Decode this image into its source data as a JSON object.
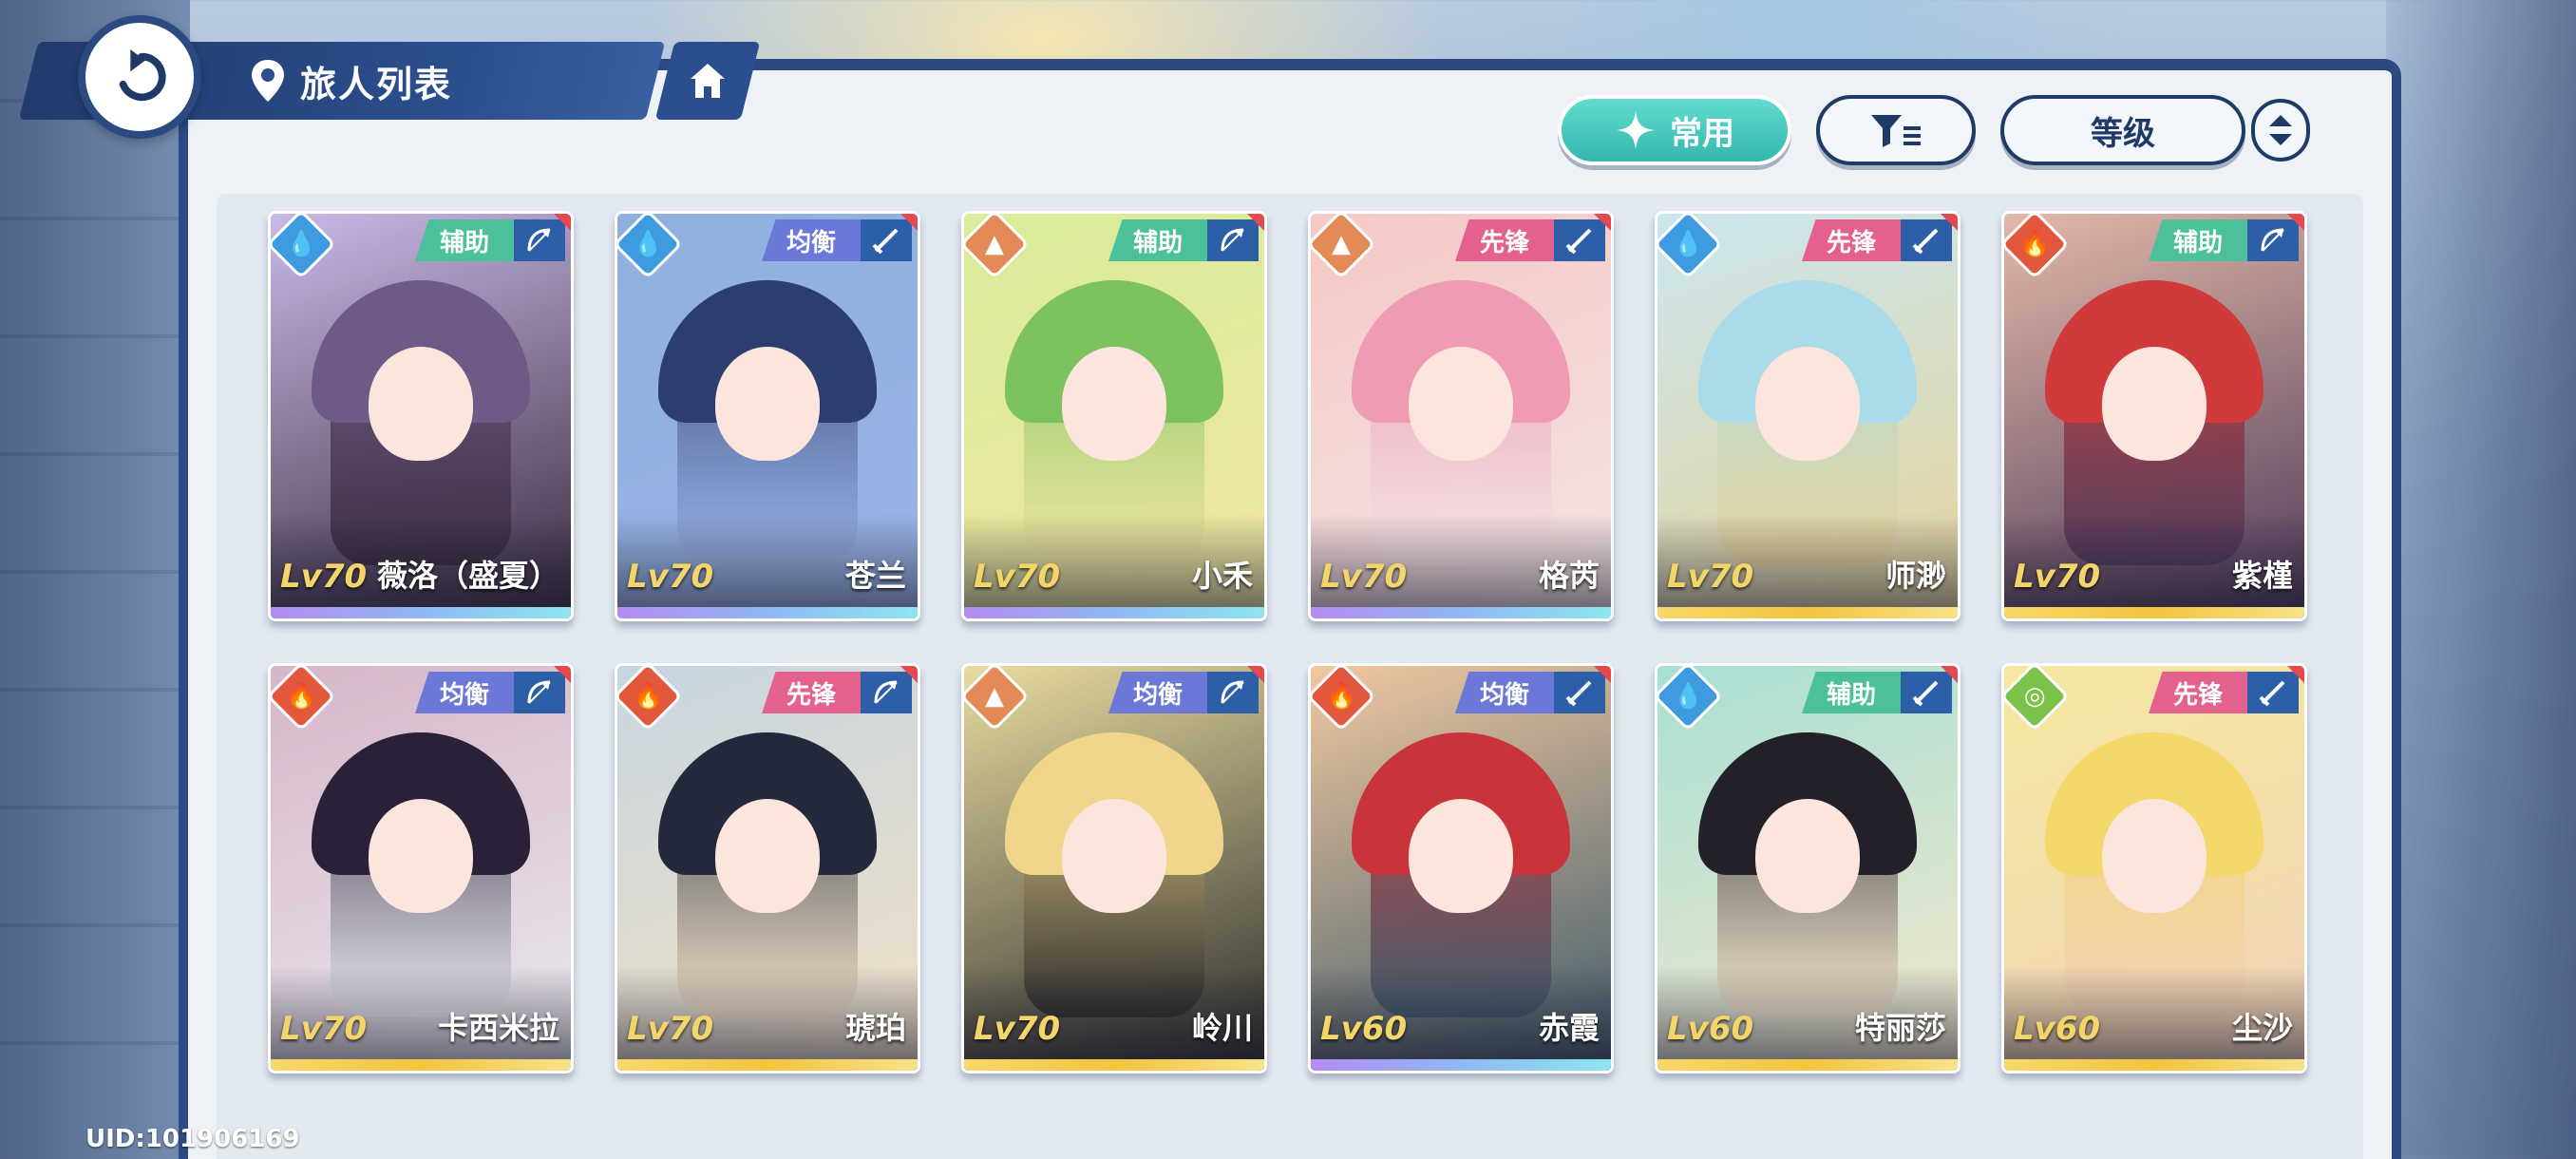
{
  "header": {
    "title": "旅人列表",
    "back_icon": "back-arrow-icon",
    "location_icon": "location-pin-icon",
    "home_icon": "home-icon"
  },
  "toolbar": {
    "common_label": "常用",
    "filter_icon": "filter-icon",
    "sort_label": "等级",
    "order_icon": "sort-order-icon"
  },
  "colors": {
    "water": "#3f9be0",
    "earth": "#e38a56",
    "fire": "#e3573c",
    "wind": "#7bc24a",
    "support": "#4cbf9b",
    "balance": "#6b78d8",
    "vanguard": "#e4608f"
  },
  "characters": [
    {
      "name": "薇洛（盛夏）",
      "level": "Lv70",
      "role": "辅助",
      "element": "water",
      "weapon": "bow-icon",
      "rarity": "purple"
    },
    {
      "name": "苍兰",
      "level": "Lv70",
      "role": "均衡",
      "element": "water",
      "weapon": "sword-icon",
      "rarity": "purple"
    },
    {
      "name": "小禾",
      "level": "Lv70",
      "role": "辅助",
      "element": "earth",
      "weapon": "bow-icon",
      "rarity": "purple"
    },
    {
      "name": "格芮",
      "level": "Lv70",
      "role": "先锋",
      "element": "earth",
      "weapon": "sword-icon",
      "rarity": "purple"
    },
    {
      "name": "师渺",
      "level": "Lv70",
      "role": "先锋",
      "element": "water",
      "weapon": "sword-icon",
      "rarity": "gold"
    },
    {
      "name": "紫槿",
      "level": "Lv70",
      "role": "辅助",
      "element": "fire",
      "weapon": "bow-icon",
      "rarity": "gold"
    },
    {
      "name": "卡西米拉",
      "level": "Lv70",
      "role": "均衡",
      "element": "fire",
      "weapon": "bow-icon",
      "rarity": "gold"
    },
    {
      "name": "琥珀",
      "level": "Lv70",
      "role": "先锋",
      "element": "fire",
      "weapon": "bow-icon",
      "rarity": "gold"
    },
    {
      "name": "岭川",
      "level": "Lv70",
      "role": "均衡",
      "element": "earth",
      "weapon": "bow-icon",
      "rarity": "gold"
    },
    {
      "name": "赤霞",
      "level": "Lv60",
      "role": "均衡",
      "element": "fire",
      "weapon": "sword-icon",
      "rarity": "purple"
    },
    {
      "name": "特丽莎",
      "level": "Lv60",
      "role": "辅助",
      "element": "water",
      "weapon": "sword-icon",
      "rarity": "gold"
    },
    {
      "name": "尘沙",
      "level": "Lv60",
      "role": "先锋",
      "element": "wind",
      "weapon": "sword-icon",
      "rarity": "gold"
    }
  ],
  "footer": {
    "uid": "UID:101906169"
  }
}
